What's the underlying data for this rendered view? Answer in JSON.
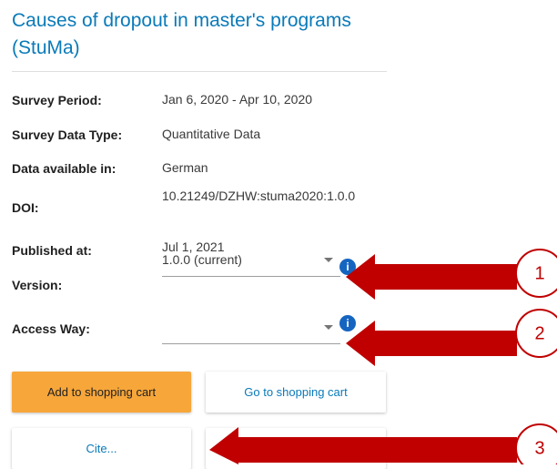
{
  "page": {
    "title": "Causes of dropout in master's programs (StuMa)"
  },
  "details": [
    {
      "label": "Survey Period:",
      "value": "Jan 6, 2020 - Apr 10, 2020"
    },
    {
      "label": "Survey Data Type:",
      "value": "Quantitative Data"
    },
    {
      "label": "Data available in:",
      "value": "German"
    },
    {
      "label": "DOI:",
      "value": "10.21249/DZHW:stuma2020:1.0.0"
    },
    {
      "label": "Published at:",
      "value": "Jul 1, 2021"
    }
  ],
  "version": {
    "label": "Version:",
    "selected": "1.0.0 (current)"
  },
  "access_way": {
    "label": "Access Way:",
    "selected": ""
  },
  "buttons": {
    "add_to_cart": "Add to shopping cart",
    "go_to_cart": "Go to shopping cart",
    "cite": "Cite..."
  },
  "annotations": {
    "callouts": [
      "1",
      "2",
      "3"
    ],
    "arrow_color": "#c00000"
  },
  "colors": {
    "title": "#0a7ab8",
    "primary_button": "#f7a63a",
    "link": "#0a7ab8",
    "info_icon": "#1565c0"
  },
  "icons": {
    "info": "info-icon",
    "dropdown": "chevron-down-icon"
  }
}
